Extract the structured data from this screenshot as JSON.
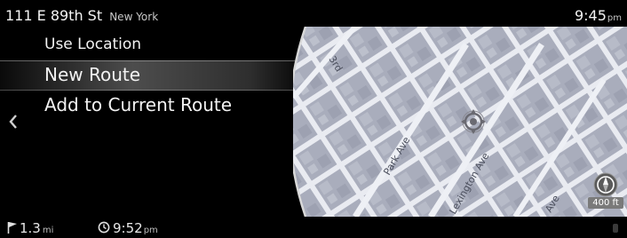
{
  "header": {
    "street": "111 E 89th St",
    "city": "New York",
    "time": "9:45",
    "ampm": "pm"
  },
  "menu": {
    "items": [
      {
        "label": "Use Location"
      },
      {
        "label": "New Route",
        "selected": true
      },
      {
        "label": "Add to Current Route"
      }
    ]
  },
  "map": {
    "streets": [
      "Park Ave",
      "Lexington Ave",
      "3rd",
      "Ave"
    ],
    "scale": "400 ft"
  },
  "footer": {
    "distance": "1.3",
    "distance_unit": "mi",
    "eta": "9:52",
    "eta_ampm": "pm"
  },
  "icons": {
    "back": "chevron-left-icon",
    "compass": "compass-icon",
    "flag": "flag-icon",
    "clock": "clock-icon",
    "location": "location-target-icon",
    "status": "status-icon"
  },
  "colors": {
    "background": "#000000",
    "map_base": "#c7cad4",
    "map_block": "#a9adbc",
    "map_road": "#e7e9f0",
    "text": "#f2f2f2"
  }
}
